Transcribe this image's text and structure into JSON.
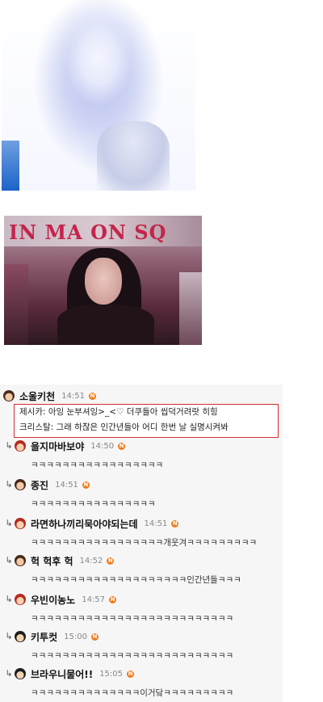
{
  "photo2": {
    "sign_text": "IN MA   ON SQ"
  },
  "main_comment": {
    "nickname": "소울키천",
    "time": "14:51",
    "badge": "N",
    "lines": [
      "제시카: 아잉 눈부셔잉>_<♡ 더쿠들아 씹덕거려랏 히힝",
      "크리스탈: 그래 하찮은 인간년들아 어디 한번 날 실명시켜봐"
    ]
  },
  "replies": [
    {
      "nickname": "을지마바보야",
      "time": "14:50",
      "badge": "N",
      "text": "ㅋㅋㅋㅋㅋㅋㅋㅋㅋㅋㅋㅋㅋㅋㅋㅋㅋ"
    },
    {
      "nickname": "종진",
      "time": "14:51",
      "badge": "N",
      "text": "ㅋㅋㅋㅋㅋㅋㅋㅋㅋㅋㅋㅋㅋㅋㅋㅋ"
    },
    {
      "nickname": "라면하나끼리묵아야되는데",
      "time": "14:51",
      "badge": "N",
      "text": "ㅋㅋㅋㅋㅋㅋㅋㅋㅋㅋㅋㅋㅋㅋㅋㅋㅋ개웃겨ㅋㅋㅋㅋㅋㅋㅋㅋㅋ"
    },
    {
      "nickname": "헉 헉후 헉",
      "time": "14:52",
      "badge": "N",
      "text": "ㅋㅋㅋㅋㅋㅋㅋㅋㅋㅋㅋㅋㅋㅋㅋㅋㅋㅋㅋㅋ인간년들ㅋㅋㅋ"
    },
    {
      "nickname": "우빈이농노",
      "time": "14:57",
      "badge": "N",
      "text": "ㅋㅋㅋㅋㅋㅋㅋㅋㅋㅋㅋㅋㅋㅋㅋㅋㅋㅋㅋㅋㅋㅋㅋㅋㅋㅋ"
    },
    {
      "nickname": "키투컷",
      "time": "15:00",
      "badge": "N",
      "text": "ㅋㅋㅋㅋㅋㅋㅋㅋㅋㅋㅋㅋㅋㅋㅋㅋㅋㅋㅋㅋㅋㅋㅋㅋㅋㅋ"
    },
    {
      "nickname": "브라우니물어!!",
      "time": "15:05",
      "badge": "N",
      "text": "ㅋㅋㅋㅋㅋㅋㅋㅋㅋㅋㅋㅋㅋㅋ이거닼ㅋㅋㅋㅋㅋㅋㅋㅋㅋ"
    }
  ]
}
